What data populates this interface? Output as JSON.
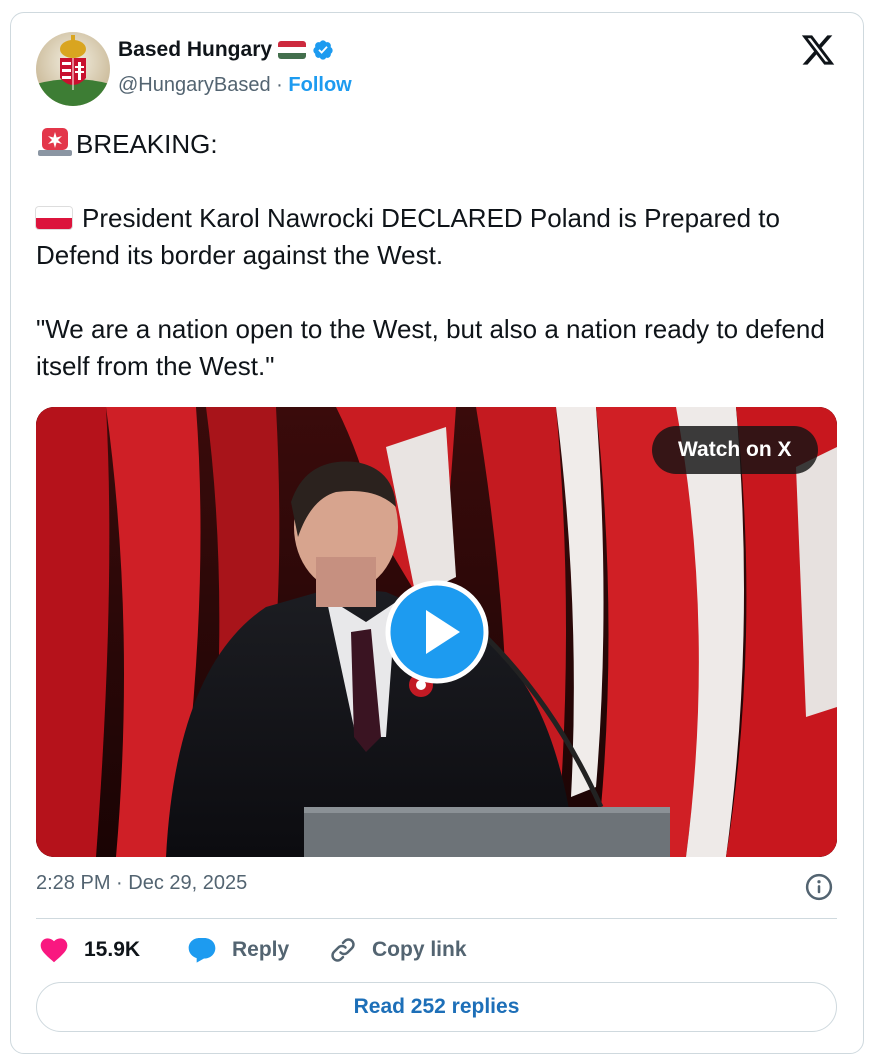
{
  "author": {
    "name": "Based Hungary",
    "handle": "@HungaryBased",
    "separator": "·",
    "follow_label": "Follow",
    "verified": true,
    "flag_icon": "hungary-flag-icon"
  },
  "tweet": {
    "breaking": "BREAKING:",
    "line1": "President Karol Nawrocki DECLARED Poland is Prepared to Defend its border against the West.",
    "quote": "\"We are a nation open to the West, but also a nation ready to defend itself from the West.\""
  },
  "media": {
    "watch_label": "Watch on X"
  },
  "meta": {
    "timestamp": "2:28 PM · Dec 29, 2025"
  },
  "actions": {
    "likes": "15.9K",
    "reply_label": "Reply",
    "copy_label": "Copy link",
    "read_replies_label": "Read 252 replies"
  },
  "colors": {
    "accent": "#1d9bf0",
    "like": "#f91880",
    "text": "#0f1419",
    "muted": "#536471"
  }
}
